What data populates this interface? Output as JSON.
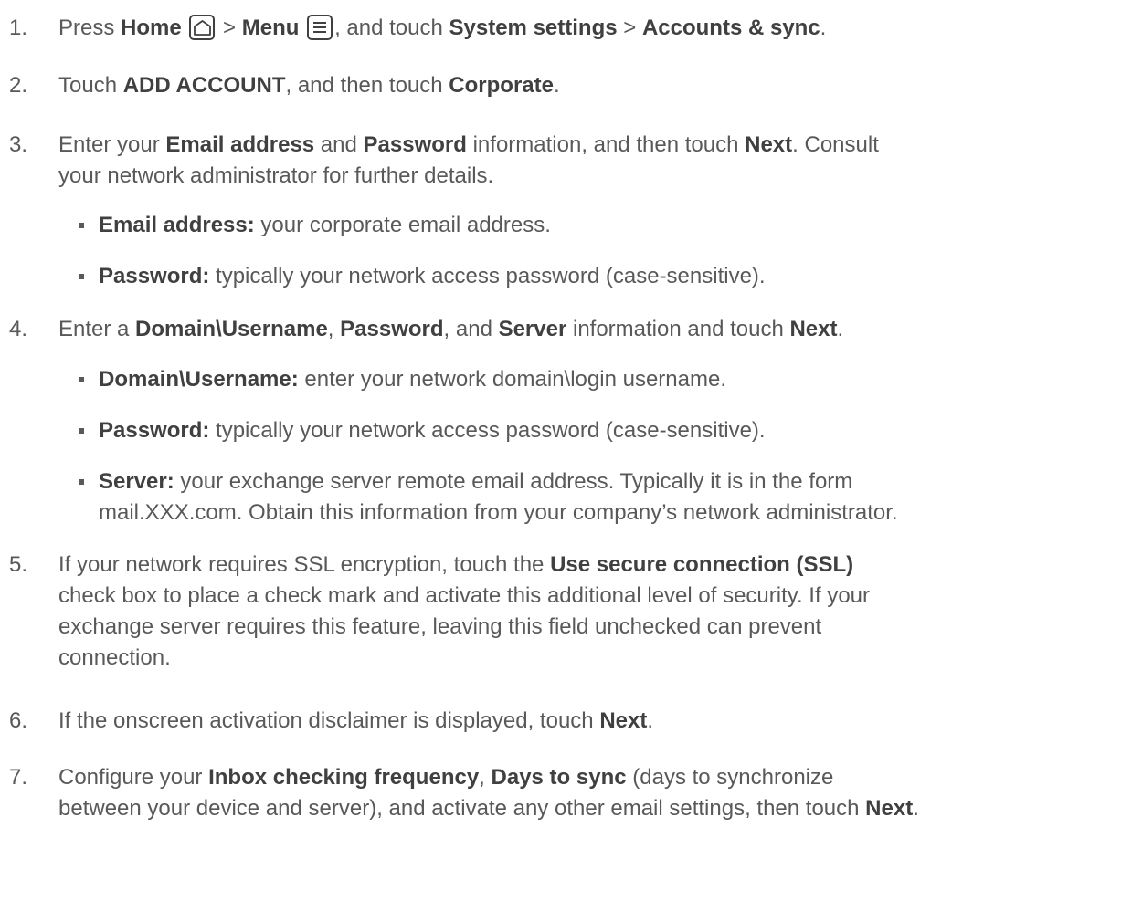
{
  "steps": [
    {
      "number": "1.",
      "segments": [
        "Press ",
        "Home",
        " > ",
        "Menu",
        ", and touch ",
        "System settings",
        " > ",
        "Accounts & sync",
        "."
      ]
    },
    {
      "number": "2.",
      "segments": [
        "Touch ",
        "ADD ACCOUNT",
        ", and then touch ",
        "Corporate",
        "."
      ]
    },
    {
      "number": "3.",
      "line1": [
        "Enter your ",
        "Email address",
        " and ",
        "Password",
        " information, and then touch ",
        "Next",
        ". Consult"
      ],
      "line2": "your network administrator for further details.",
      "bullets": [
        {
          "label": "Email address:",
          "text": " your corporate email address."
        },
        {
          "label": "Password:",
          "text": " typically your network access password (case-sensitive)."
        }
      ]
    },
    {
      "number": "4.",
      "segments": [
        "Enter a ",
        "Domain\\Username",
        ", ",
        "Password",
        ", and ",
        "Server",
        " information and touch ",
        "Next",
        "."
      ],
      "bullets": [
        {
          "label": "Domain\\Username:",
          "text": " enter your network domain\\login username."
        },
        {
          "label": "Password:",
          "text": " typically your network access password (case-sensitive)."
        },
        {
          "label": "Server:",
          "text": " your exchange server remote email address. Typically it is in the form",
          "line2": "mail.XXX.com. Obtain this information from your company’s network administrator."
        }
      ]
    },
    {
      "number": "5.",
      "line1": [
        "If your network requires SSL encryption, touch the ",
        "Use secure connection (SSL)"
      ],
      "line2": "check box to place a check mark and activate this additional level of security. If your",
      "line3": "exchange server requires this feature, leaving this field unchecked can prevent",
      "line4": "connection."
    },
    {
      "number": "6.",
      "segments": [
        "If the onscreen activation disclaimer is displayed, touch ",
        "Next",
        "."
      ]
    },
    {
      "number": "7.",
      "line1": [
        "Configure your ",
        "Inbox checking frequency",
        ", ",
        "Days to sync",
        " (days to synchronize"
      ],
      "line2": [
        "between your device and server), and activate any other email settings, then touch ",
        "Next",
        "."
      ]
    }
  ],
  "icons": {
    "home": "home-icon",
    "menu": "menu-icon"
  }
}
